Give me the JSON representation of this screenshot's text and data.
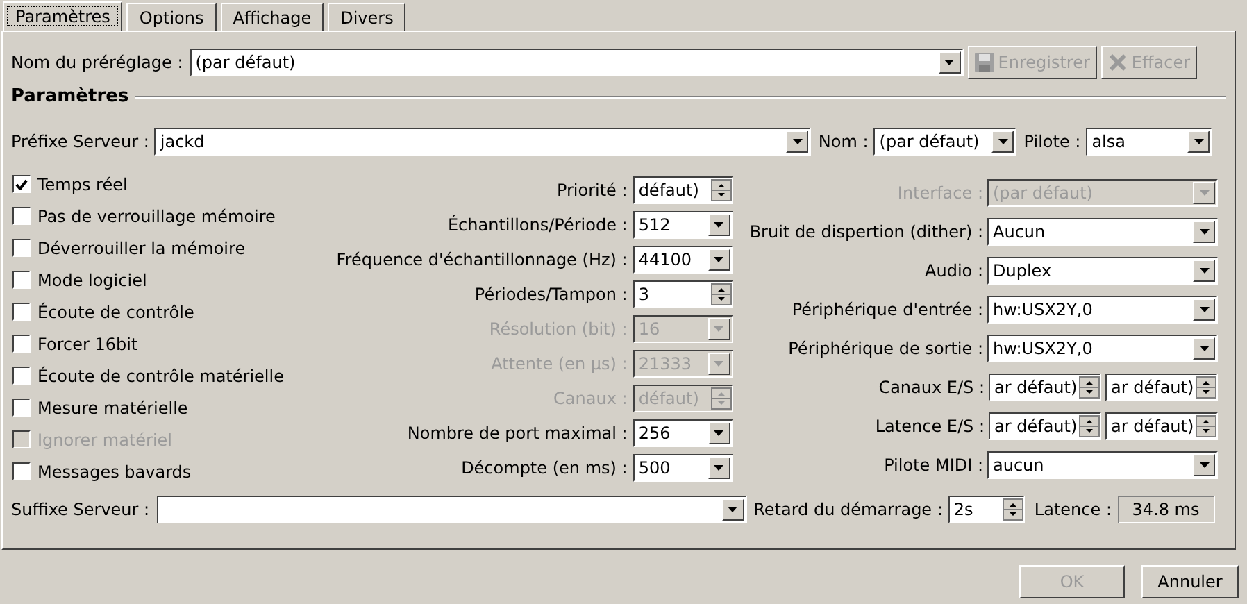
{
  "tabs": [
    {
      "label": "Paramètres",
      "selected": true
    },
    {
      "label": "Options",
      "selected": false
    },
    {
      "label": "Affichage",
      "selected": false
    },
    {
      "label": "Divers",
      "selected": false
    }
  ],
  "preset": {
    "label": "Nom du préréglage :",
    "value": "(par défaut)"
  },
  "preset_buttons": [
    {
      "label": "Enregistrer",
      "kind": "save",
      "disabled": true
    },
    {
      "label": "Effacer",
      "kind": "delete",
      "disabled": true
    }
  ],
  "group_title": "Paramètres",
  "server_row": [
    {
      "label": "Préfixe Serveur :",
      "value": "jackd"
    },
    {
      "label": "Nom :",
      "value": "(par défaut)"
    },
    {
      "label": "Pilote :",
      "value": "alsa"
    }
  ],
  "options": [
    {
      "label": "Temps réel",
      "checked": true,
      "disabled": false
    },
    {
      "label": "Pas de verrouillage mémoire",
      "checked": false,
      "disabled": false
    },
    {
      "label": "Déverrouiller la mémoire",
      "checked": false,
      "disabled": false
    },
    {
      "label": "Mode logiciel",
      "checked": false,
      "disabled": false
    },
    {
      "label": "Écoute de contrôle",
      "checked": false,
      "disabled": false
    },
    {
      "label": "Forcer 16bit",
      "checked": false,
      "disabled": false
    },
    {
      "label": "Écoute de contrôle matérielle",
      "checked": false,
      "disabled": false
    },
    {
      "label": "Mesure matérielle",
      "checked": false,
      "disabled": false
    },
    {
      "label": "Ignorer matériel",
      "checked": false,
      "disabled": true
    },
    {
      "label": "Messages bavards",
      "checked": false,
      "disabled": false
    }
  ],
  "middle_fields": [
    {
      "label": "Priorité :",
      "kind": "spin",
      "values": [
        "défaut)"
      ],
      "disabled": false
    },
    {
      "label": "Échantillons/Période :",
      "kind": "combo",
      "values": [
        "512"
      ],
      "disabled": false
    },
    {
      "label": "Fréquence d'échantillonnage (Hz) :",
      "kind": "combo",
      "values": [
        "44100"
      ],
      "disabled": false
    },
    {
      "label": "Périodes/Tampon :",
      "kind": "spin",
      "values": [
        "3"
      ],
      "disabled": false
    },
    {
      "label": "Résolution (bit) :",
      "kind": "combo",
      "values": [
        "16"
      ],
      "disabled": true
    },
    {
      "label": "Attente (en µs) :",
      "kind": "combo",
      "values": [
        "21333"
      ],
      "disabled": true
    },
    {
      "label": "Canaux :",
      "kind": "spin",
      "values": [
        "défaut)"
      ],
      "disabled": true
    },
    {
      "label": "Nombre de port maximal :",
      "kind": "combo",
      "values": [
        "256"
      ],
      "disabled": false
    },
    {
      "label": "Décompte (en ms) :",
      "kind": "combo",
      "values": [
        "500"
      ],
      "disabled": false
    }
  ],
  "right_fields": [
    {
      "label": "Interface :",
      "kind": "combo",
      "values": [
        "(par défaut)"
      ],
      "disabled": true
    },
    {
      "label": "Bruit de dispertion (dither) :",
      "kind": "combo",
      "values": [
        "Aucun"
      ],
      "disabled": false
    },
    {
      "label": "Audio :",
      "kind": "combo",
      "values": [
        "Duplex"
      ],
      "disabled": false
    },
    {
      "label": "Périphérique d'entrée :",
      "kind": "combo",
      "values": [
        "hw:USX2Y,0"
      ],
      "disabled": false
    },
    {
      "label": "Périphérique de sortie :",
      "kind": "combo",
      "values": [
        "hw:USX2Y,0"
      ],
      "disabled": false
    },
    {
      "label": "Canaux E/S :",
      "kind": "spin",
      "values": [
        "ar défaut)",
        "ar défaut)"
      ],
      "disabled": false
    },
    {
      "label": "Latence E/S :",
      "kind": "spin",
      "values": [
        "ar défaut)",
        "ar défaut)"
      ],
      "disabled": false
    },
    {
      "label": "Pilote MIDI :",
      "kind": "combo",
      "values": [
        "aucun"
      ],
      "disabled": false
    }
  ],
  "suffix": {
    "label": "Suffixe Serveur :"
  },
  "startup_delay": {
    "label": "Retard du démarrage :",
    "value": "2s"
  },
  "latency": {
    "label": "Latence :",
    "value": "34.8 ms"
  },
  "dialog_buttons": [
    {
      "label": "OK",
      "disabled": true
    },
    {
      "label": "Annuler",
      "disabled": false
    }
  ]
}
